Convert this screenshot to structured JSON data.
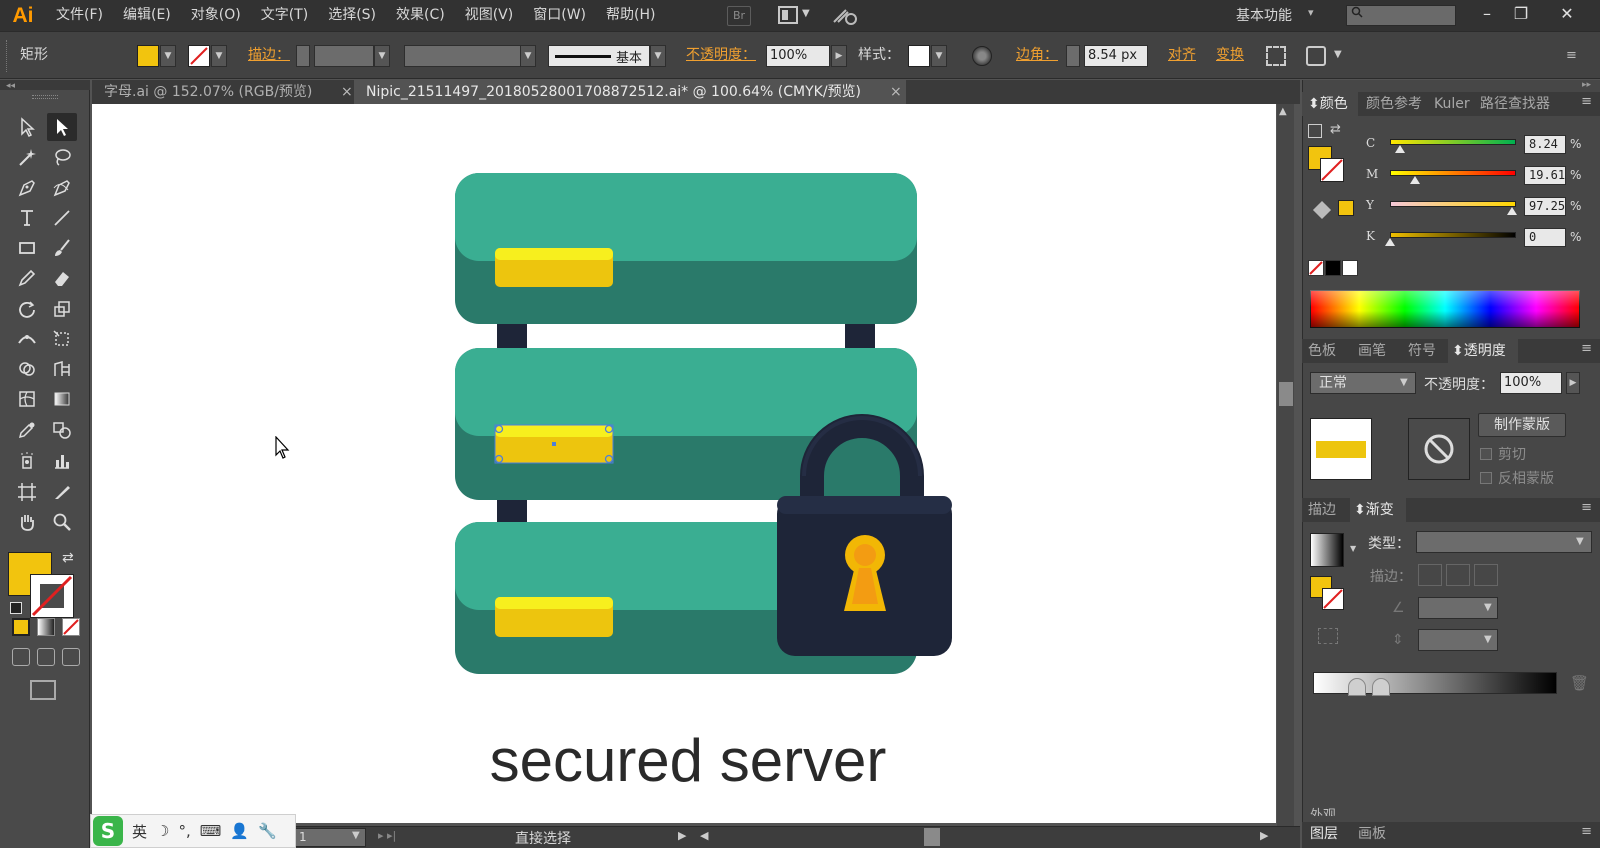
{
  "app": {
    "logo": "Ai",
    "menu": [
      "文件(F)",
      "编辑(E)",
      "对象(O)",
      "文字(T)",
      "选择(S)",
      "效果(C)",
      "视图(V)",
      "窗口(W)",
      "帮助(H)"
    ],
    "bridge_label": "Br",
    "workspace": "基本功能",
    "window_buttons": [
      "–",
      "❐",
      "✕"
    ]
  },
  "control_bar": {
    "object_type": "矩形",
    "stroke_label": "描边：",
    "stroke_style": "基本",
    "opacity_label": "不透明度：",
    "opacity_value": "100%",
    "style_label": "样式：",
    "corner_label": "边角：",
    "corner_value": "8.54 px",
    "align_label": "对齐",
    "transform_label": "变换"
  },
  "tabs": [
    {
      "label": "字母.ai @ 152.07% (RGB/预览)",
      "active": false
    },
    {
      "label": "Nipic_21511497_20180528001708872512.ai* @ 100.64% (CMYK/预览)",
      "active": true
    }
  ],
  "artwork": {
    "caption": "secured server",
    "colors": {
      "teal_light": "#3aae92",
      "teal_dark": "#2a7a6a",
      "slot_yellow": "#edc50e",
      "slot_highlight": "#f7ef1e",
      "lock_body": "#1e2538",
      "keyhole": "#f2b705",
      "keyhole_inner": "#f39c12"
    }
  },
  "status_bar": {
    "zoom": "1",
    "tool": "直接选择"
  },
  "ime": {
    "logo": "S",
    "mode": "英",
    "items": [
      "☽",
      "°,",
      "⌨",
      "👤",
      "🔧"
    ]
  },
  "panels": {
    "color": {
      "tabs": [
        "颜色",
        "颜色参考",
        "Kuler",
        "路径查找器"
      ],
      "channels": [
        {
          "name": "C",
          "value": "8.24",
          "level": 0.08,
          "gradient": "linear-gradient(to right,#ffe600,#00b050)"
        },
        {
          "name": "M",
          "value": "19.61",
          "level": 0.2,
          "gradient": "linear-gradient(to right,#ffff00,#ff0000)"
        },
        {
          "name": "Y",
          "value": "97.25",
          "level": 0.97,
          "gradient": "linear-gradient(to right,#f5c8d8,#ffd600)"
        },
        {
          "name": "K",
          "value": "0",
          "level": 0.0,
          "gradient": "linear-gradient(to right,#f0c000,#000000)"
        }
      ],
      "pct": "%",
      "fill": "#f2c40e"
    },
    "transparency": {
      "tabs": [
        "色板",
        "画笔",
        "符号",
        "透明度"
      ],
      "blend_mode": "正常",
      "opacity_label": "不透明度：",
      "opacity_value": "100%",
      "make_mask": "制作蒙版",
      "clip": "剪切",
      "invert_mask": "反相蒙版"
    },
    "gradient": {
      "tabs": [
        "描边",
        "渐变"
      ],
      "type_label": "类型：",
      "stroke_label": "描边："
    },
    "layers": {
      "tabs": [
        "图层",
        "画板"
      ],
      "appearance_label": "外观"
    }
  }
}
